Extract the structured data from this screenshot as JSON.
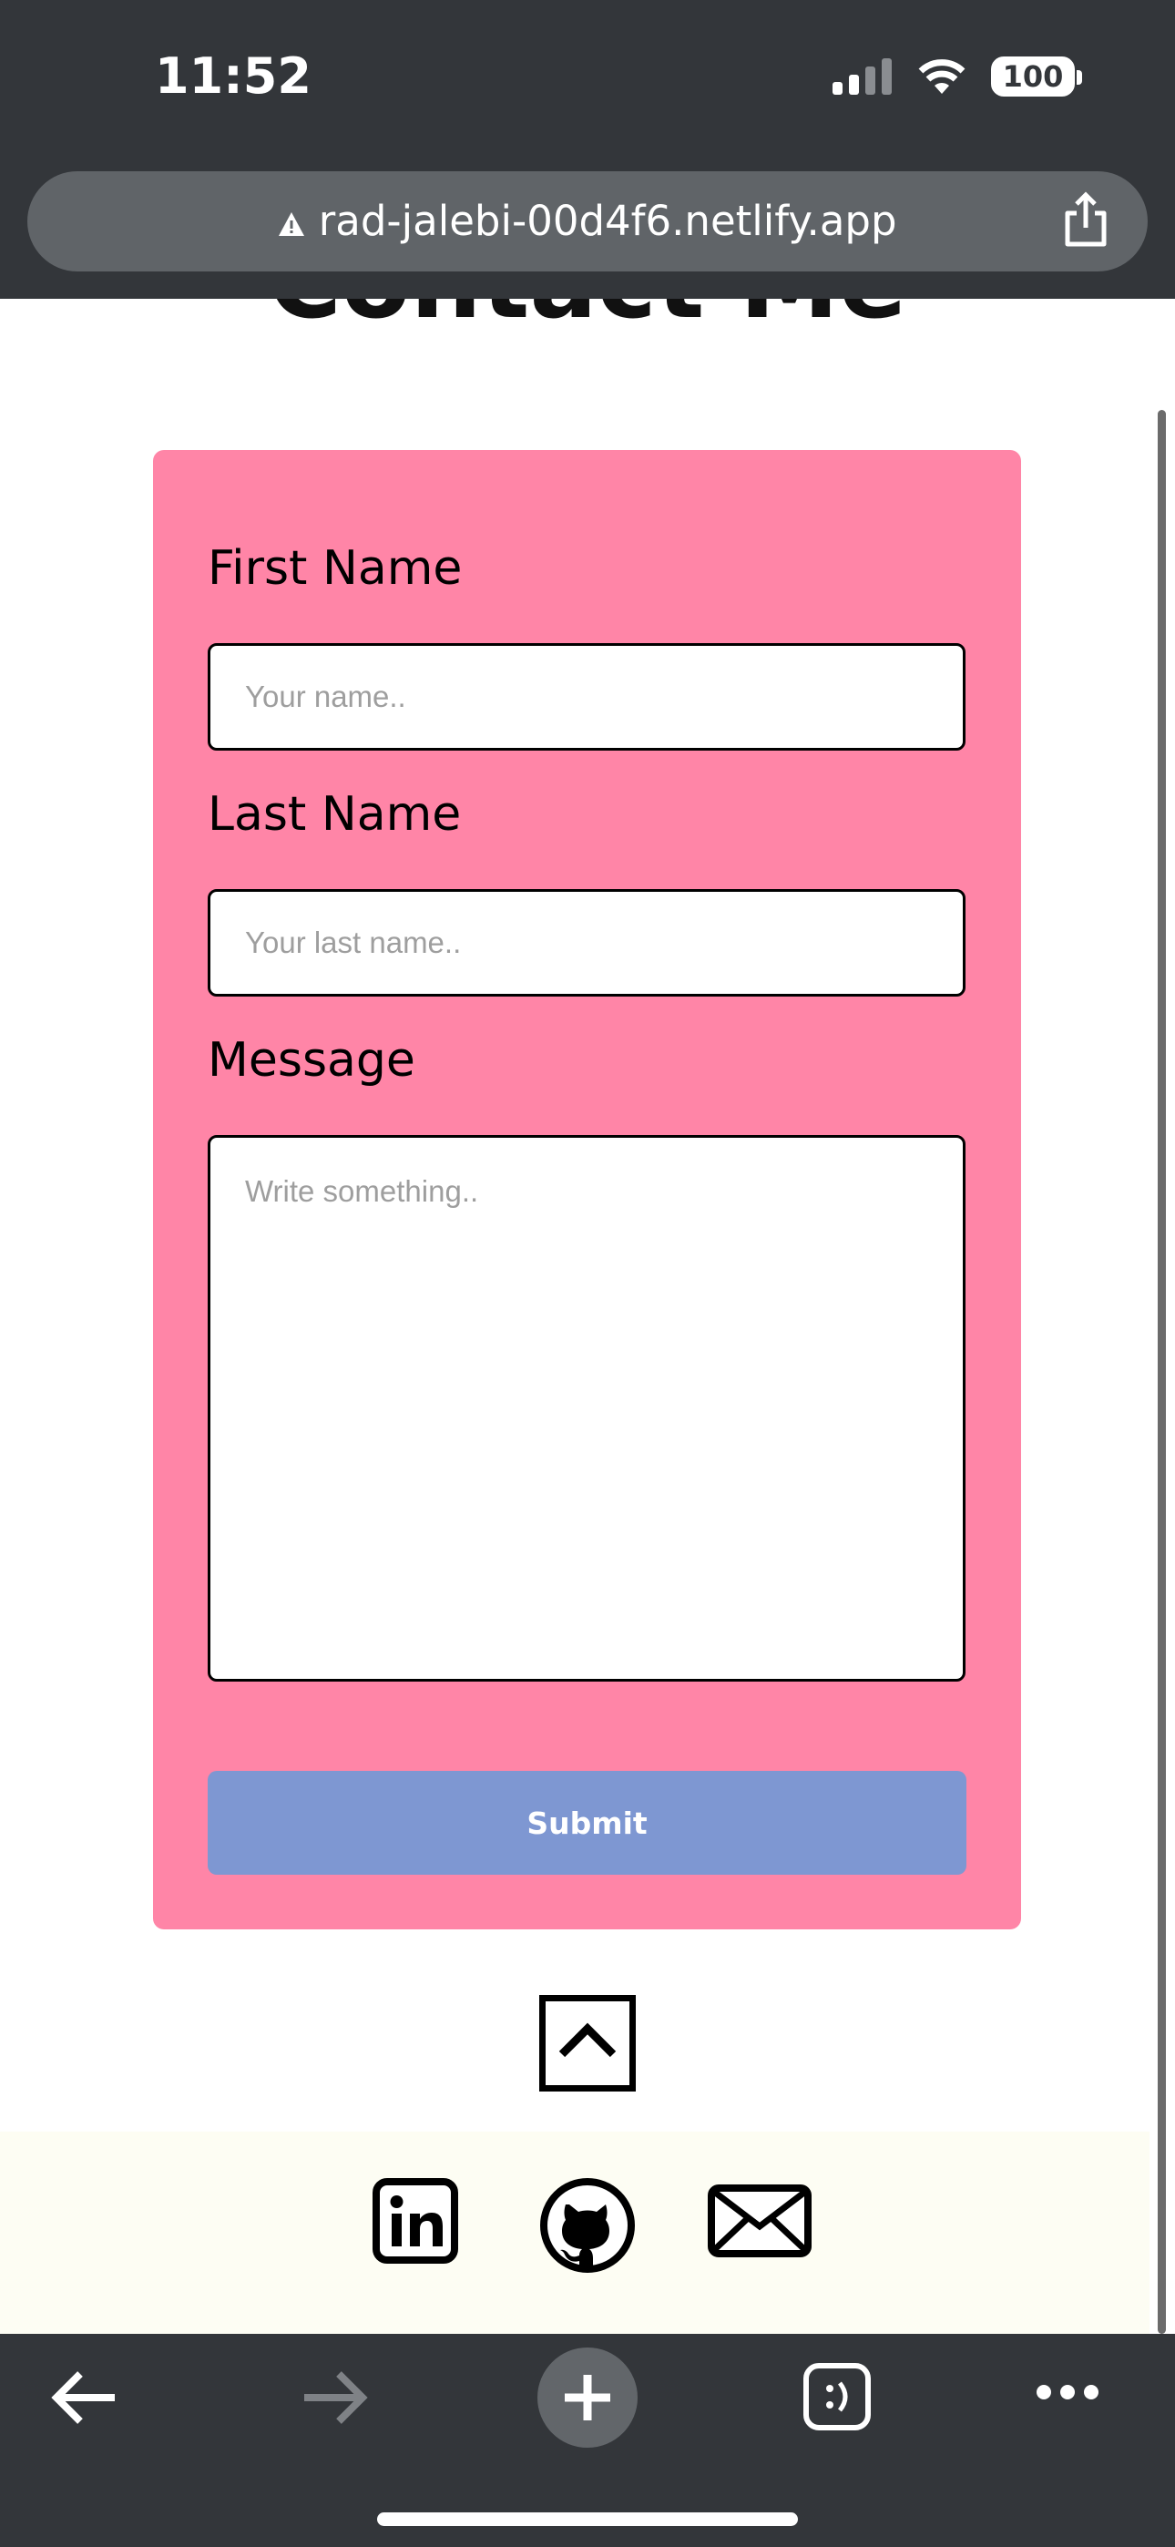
{
  "status_bar": {
    "time": "11:52",
    "battery": "100"
  },
  "browser": {
    "url": "rad-jalebi-00d4f6.netlify.app"
  },
  "page": {
    "heading": "Contact Me",
    "form": {
      "first_name_label": "First Name",
      "first_name_placeholder": "Your name..",
      "first_name_value": "",
      "last_name_label": "Last Name",
      "last_name_placeholder": "Your last name..",
      "last_name_value": "",
      "message_label": "Message",
      "message_placeholder": "Write something..",
      "message_value": "",
      "submit_label": "Submit"
    },
    "colors": {
      "form_bg": "#ff85a7",
      "submit_bg": "#7e97d2",
      "footer_bg": "#fdfdf3",
      "chrome_bg": "#33363a"
    },
    "icons": {
      "scroll_top": "chevron-up-icon",
      "social": [
        "linkedin-icon",
        "github-icon",
        "mail-icon"
      ]
    }
  },
  "toolbar": {
    "icons": [
      "back-arrow-icon",
      "forward-arrow-icon",
      "new-tab-plus-icon",
      "tabs-icon",
      "more-icon"
    ]
  }
}
